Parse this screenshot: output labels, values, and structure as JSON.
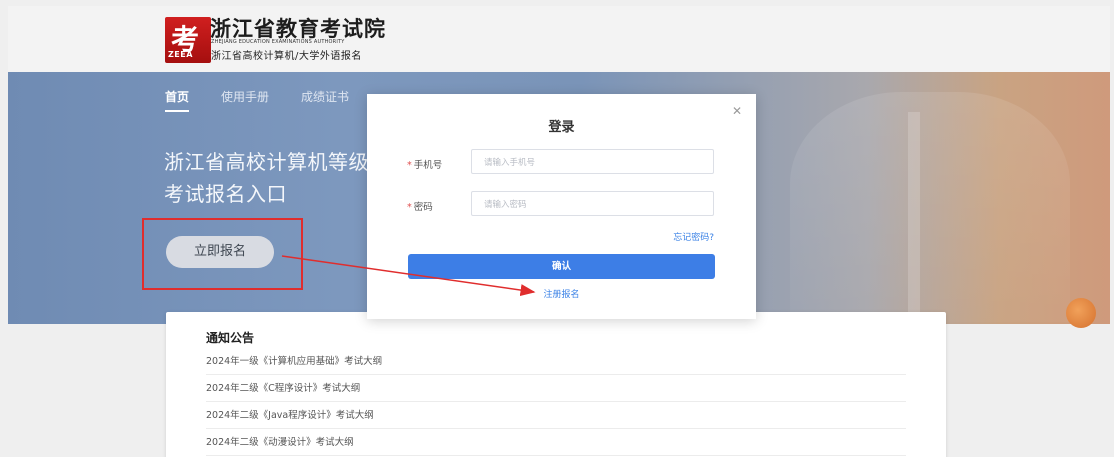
{
  "header": {
    "logo_glyph": "考",
    "logo_abbr": "ZEEA",
    "title": "浙江省教育考试院",
    "title_en": "ZHEJIANG EDUCATION EXAMINATIONS AUTHORITY",
    "subtitle": "浙江省高校计算机/大学外语报名"
  },
  "nav": {
    "items": [
      {
        "label": "首页"
      },
      {
        "label": "使用手册"
      },
      {
        "label": "成绩证书"
      }
    ]
  },
  "hero": {
    "title": "浙江省高校计算机等级考试报名入口",
    "register_label": "立即报名"
  },
  "notice": {
    "title": "通知公告",
    "items": [
      "2024年一级《计算机应用基础》考试大纲",
      "2024年二级《C程序设计》考试大纲",
      "2024年二级《Java程序设计》考试大纲",
      "2024年二级《动漫设计》考试大纲"
    ]
  },
  "login_modal": {
    "title": "登录",
    "close_icon": "close-icon",
    "phone_label": "手机号",
    "phone_placeholder": "请输入手机号",
    "password_label": "密码",
    "password_placeholder": "请输入密码",
    "required_mark": "*",
    "forgot_label": "忘记密码?",
    "confirm_label": "确认",
    "signup_label": "注册报名"
  },
  "colors": {
    "accent": "#3d7ee6",
    "link": "#3b82e6",
    "annotation_red": "#e02d2d",
    "brand_red": "#c81a1a"
  }
}
